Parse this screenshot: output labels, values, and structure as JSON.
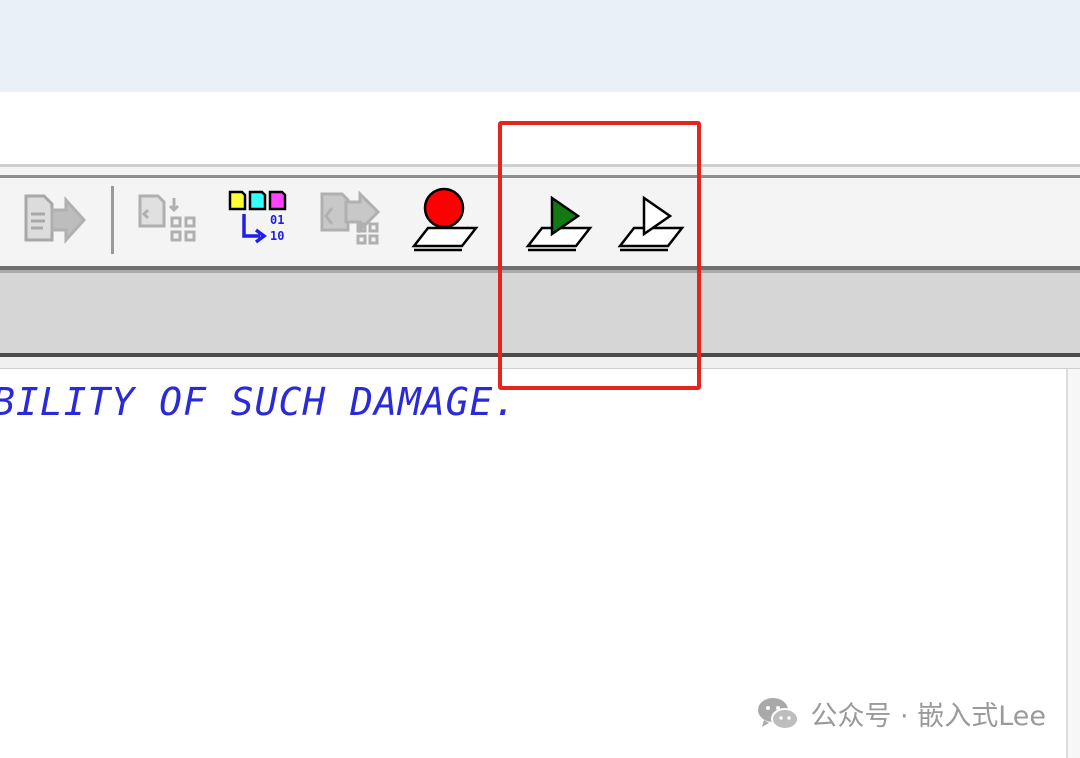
{
  "editor": {
    "code_line": "BILITY OF SUCH DAMAGE."
  },
  "toolbar": {
    "buttons": [
      {
        "icon": "export-doc-icon",
        "state": "disabled"
      },
      {
        "icon": "compare-doc-icon",
        "state": "disabled"
      },
      {
        "icon": "binary-transfer-icon",
        "state": "enabled"
      },
      {
        "icon": "disassembly-icon",
        "state": "disabled"
      },
      {
        "icon": "record-red-circle-icon",
        "state": "enabled"
      },
      {
        "icon": "play-green-triangle-icon",
        "state": "enabled"
      },
      {
        "icon": "play-outline-triangle-icon",
        "state": "enabled"
      }
    ]
  },
  "annotation": {
    "color": "#e8231e",
    "highlights": "play buttons"
  },
  "watermark": {
    "text": "公众号 · 嵌入式Lee",
    "icon": "wechat-icon"
  },
  "colors": {
    "code_text": "#2a2ad8",
    "record_red": "#ff0000",
    "play_green": "#127a12"
  }
}
